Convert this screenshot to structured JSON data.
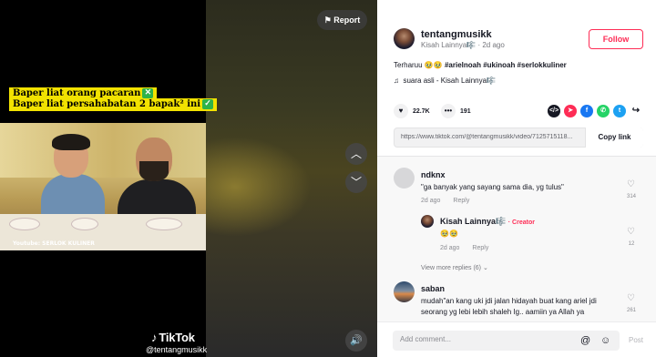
{
  "video": {
    "caption_line1": "Baper liat orang pacaran",
    "caption_line2": "Baper liat persahabatan 2 bapak² ini",
    "credit": "Youtube: SERLOK KULINER",
    "tiktok_logo": "TikTok",
    "handle": "@tentangmusikk",
    "report_label": "Report",
    "check_glyph": "✕",
    "check2_glyph": "✓"
  },
  "author": {
    "username": "tentangmusikk",
    "display_name": "Kisah Lainnya",
    "badge": "🎼",
    "time_ago": "2d ago",
    "follow_label": "Follow"
  },
  "post": {
    "description_text": "Terharuu",
    "emojis": "🥹🥹",
    "hashtags": "#arielnoah #ukinoah #serlokkuliner",
    "sound": "suara asli - Kisah Lainnya",
    "likes": "22.7K",
    "comments": "191",
    "link": "https://www.tiktok.com/@tentangmusikk/video/7125715118...",
    "copy_label": "Copy link"
  },
  "share_icons": [
    {
      "name": "embed-icon",
      "color": "#161823"
    },
    {
      "name": "send-icon",
      "color": "#fe2c55"
    },
    {
      "name": "facebook-icon",
      "color": "#1877f2"
    },
    {
      "name": "whatsapp-icon",
      "color": "#25d366"
    },
    {
      "name": "twitter-icon",
      "color": "#1da1f2"
    },
    {
      "name": "share-icon",
      "color": "#161823"
    }
  ],
  "comments": [
    {
      "user": "ndknx",
      "text": "\"ga banyak yang sayang sama dia, yg tulus\"",
      "time": "2d ago",
      "reply": "Reply",
      "likes": "314"
    },
    {
      "user": "Kisah Lainnya",
      "creator": "Creator",
      "text": "🥹🥹",
      "time": "2d ago",
      "reply": "Reply",
      "likes": "12"
    },
    {
      "user": "saban",
      "text": "mudah\"an kang uki jdi jalan hidayah buat kang ariel jdi seorang yg lebi lebih shaleh Ig.. aamiin ya Allah ya",
      "likes": "261"
    }
  ],
  "view_more": "View more replies (6)",
  "comment_box": {
    "placeholder": "Add comment...",
    "post_label": "Post"
  }
}
